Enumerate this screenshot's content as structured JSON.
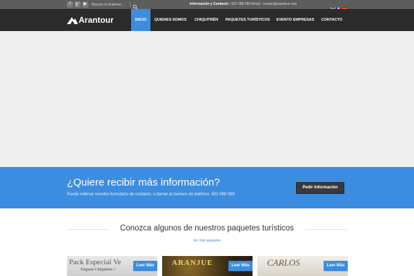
{
  "topbar": {
    "social": [
      {
        "name": "facebook-icon",
        "glyph": "f"
      },
      {
        "name": "google-plus-icon",
        "glyph": "g⁺"
      },
      {
        "name": "youtube-icon",
        "glyph": "▶"
      }
    ],
    "search": {
      "placeholder": "Buscar en Arantour..."
    },
    "contact": {
      "label": "Información y Contacto :",
      "details": "902 088 089 Email : contac@arantour.com"
    },
    "languages": [
      "english-flag-icon",
      "french-flag-icon",
      "spanish-flag-icon"
    ]
  },
  "navbar": {
    "logo_text": "Arantour",
    "items": [
      {
        "label": "INICIO",
        "active": true
      },
      {
        "label": "QUIENES SOMOS",
        "active": false
      },
      {
        "label": "CHIQUITRÉN",
        "active": false
      },
      {
        "label": "PAQUETES TURÍSTICOS",
        "active": false
      },
      {
        "label": "EVENTO EMPRESAS",
        "active": false
      },
      {
        "label": "CONTACTO",
        "active": false
      }
    ]
  },
  "cta": {
    "title": "¿Quiere recibir más información?",
    "text": "Puede rellenar nuestro formulario de contacto, o llamar al numero de teléfono: 902 088 089.",
    "button": "Pedir Información"
  },
  "packages": {
    "title": "Conozca algunos de nuestros paquetes turísticos",
    "more_link": "Ver más paquetes",
    "cards": [
      {
        "caption": "Pack Especial Ve",
        "subcaption": "Paquete Chiquitren +",
        "button": "Leer Más"
      },
      {
        "caption": "ARANJUE",
        "subcaption": "",
        "button": "Leer Más"
      },
      {
        "caption": "CARLOS",
        "subcaption": "",
        "button": "Leer Más"
      }
    ]
  },
  "colors": {
    "accent": "#3c8ddf",
    "topbar": "#5d5d5d",
    "navbar": "#2b2b2b",
    "hero": "#efefef"
  }
}
